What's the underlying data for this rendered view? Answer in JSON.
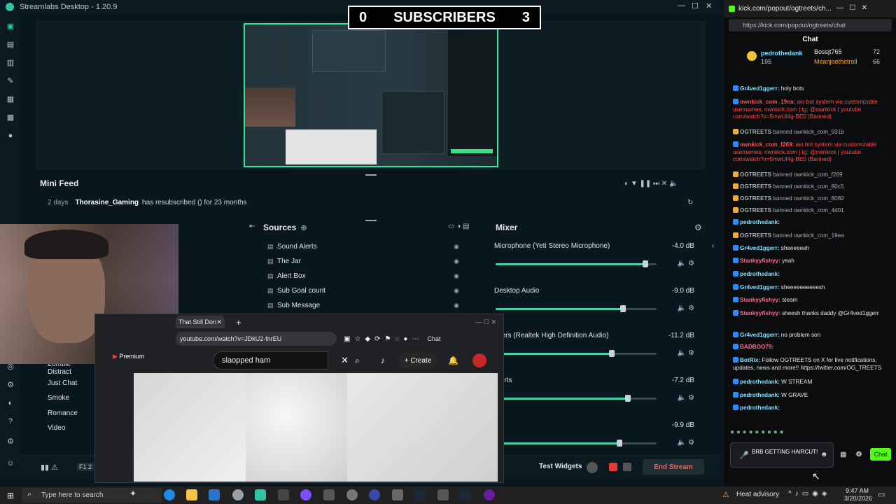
{
  "streamlabs": {
    "title": "Streamlabs Desktop - 1.20.9",
    "subscriber_banner": {
      "left": "0",
      "label": "SUBSCRIBERS",
      "right": "3"
    },
    "minifeed": {
      "title": "Mini Feed",
      "event": {
        "time": "2 days",
        "user": "Thorasine_Gaming",
        "text": "has resubscribed () for 23 months"
      }
    },
    "sources": {
      "title": "Sources",
      "items": [
        "Sound Alerts",
        "The Jar",
        "Alert Box",
        "Sub Goal count",
        "Sub Message"
      ]
    },
    "mixer": {
      "title": "Mixer",
      "channels": [
        {
          "name": "Microphone (Yeti Stereo Microphone)",
          "db": "-4.0 dB",
          "level": 0.93
        },
        {
          "name": "Desktop Audio",
          "db": "-9.0 dB",
          "level": 0.79
        },
        {
          "name": "akers (Realtek High Definition Audio)",
          "db": "-11.2 dB",
          "level": 0.72
        },
        {
          "name": "Alerts",
          "db": "-7.2 dB",
          "level": 0.82
        },
        {
          "name": "",
          "db": "-9.9 dB",
          "level": 0.77
        }
      ]
    },
    "scenes": [
      "Zombie Distract",
      "Just Chat",
      "Smoke",
      "Romance",
      "Video"
    ],
    "bottom": {
      "test_widgets": "Test Widgets",
      "end_stream": "End Stream",
      "f_label": "F1 2"
    }
  },
  "browser": {
    "tab_title": "That Still Don",
    "url": "youtube.com/watch?v=JDkU2-fnrEU",
    "chat_btn": "Chat",
    "search_query": "slaopped ham",
    "create_label": "Create",
    "premium_label": "Premium"
  },
  "kick": {
    "window_title": "kick.com/popout/ogtreets/ch...",
    "url": "https://kick.com/popout/ogtreets/chat",
    "panel_title": "Chat",
    "leaders": [
      {
        "name": "pedrothedank",
        "value": "195"
      },
      {
        "name": "Bossjt765",
        "value": "72"
      },
      {
        "name": "Meanjoethetroll",
        "value": "66"
      }
    ],
    "messages": [
      {
        "user": "Gr4ved1ggerr:",
        "text": "holy bots",
        "color": "#7ee0ff"
      },
      {
        "user": "ownkick_com_19ea:",
        "text": "aio bot system via customizable usernames, ownkick.com | tg: @ownkick | youtube com/watch?v=5mwUl4g-BE0 (Banned)",
        "color": "#ff4d4d"
      },
      {
        "user": "OGTREETS",
        "text": "banned ownkick_com_931b",
        "color": "#aab0b6"
      },
      {
        "user": "ownkick_com_f269:",
        "text": "aio bot system via customizable usernames, ownkick.com | tg: @ownkick | youtube com/watch?v=5mwUl4g-BE0 (Banned)",
        "color": "#ff4d4d"
      },
      {
        "user": "OGTREETS",
        "text": "banned ownkick_com_f269",
        "color": "#aab0b6"
      },
      {
        "user": "OGTREETS",
        "text": "banned ownkick_com_80c5",
        "color": "#aab0b6"
      },
      {
        "user": "OGTREETS",
        "text": "banned ownkick_com_8082",
        "color": "#aab0b6"
      },
      {
        "user": "OGTREETS",
        "text": "banned ownkick_com_4d01",
        "color": "#aab0b6"
      },
      {
        "user": "pedrothedank:",
        "text": "",
        "color": "#7ee0ff"
      },
      {
        "user": "OGTREETS",
        "text": "banned ownkick_com_19ea",
        "color": "#aab0b6"
      },
      {
        "user": "Gr4ved1ggerr:",
        "text": "sheeeeeeh",
        "color": "#7ee0ff"
      },
      {
        "user": "Stankyyfishyy:",
        "text": "yeah",
        "color": "#ff6b8a"
      },
      {
        "user": "pedrothedank:",
        "text": "",
        "color": "#7ee0ff"
      },
      {
        "user": "Gr4ved1ggerr:",
        "text": "sheeeeeeeeeesh",
        "color": "#7ee0ff"
      },
      {
        "user": "Stankyyfishyy:",
        "text": "steam",
        "color": "#ff6b8a"
      },
      {
        "user": "Stankyyfishyy:",
        "text": "sheesh thanks daddy @Gr4ved1ggerr",
        "color": "#ff6b8a"
      },
      {
        "user": "Gr4ved1ggerr:",
        "text": "no problem son",
        "color": "#7ee0ff"
      },
      {
        "user": "BADBOO79:",
        "text": "",
        "color": "#ff6b8a"
      },
      {
        "user": "BotRix:",
        "text": "Follow OGTREETS on X for live notifications, updates, news and more!! https://twitter.com/OG_TREETS",
        "color": "#7ee0ff"
      },
      {
        "user": "pedrothedank:",
        "text": "W STREAM",
        "color": "#7ee0ff"
      },
      {
        "user": "pedrothedank:",
        "text": "W GRAVE",
        "color": "#7ee0ff"
      },
      {
        "user": "pedrothedank:",
        "text": "",
        "color": "#7ee0ff"
      }
    ],
    "input_text": "BRB GETTING HAIRCUT!",
    "send_label": "Chat"
  },
  "taskbar": {
    "search_placeholder": "Type here to search",
    "weather": "Heat advisory",
    "time": "9:47 AM",
    "date": "3/20/2026"
  }
}
